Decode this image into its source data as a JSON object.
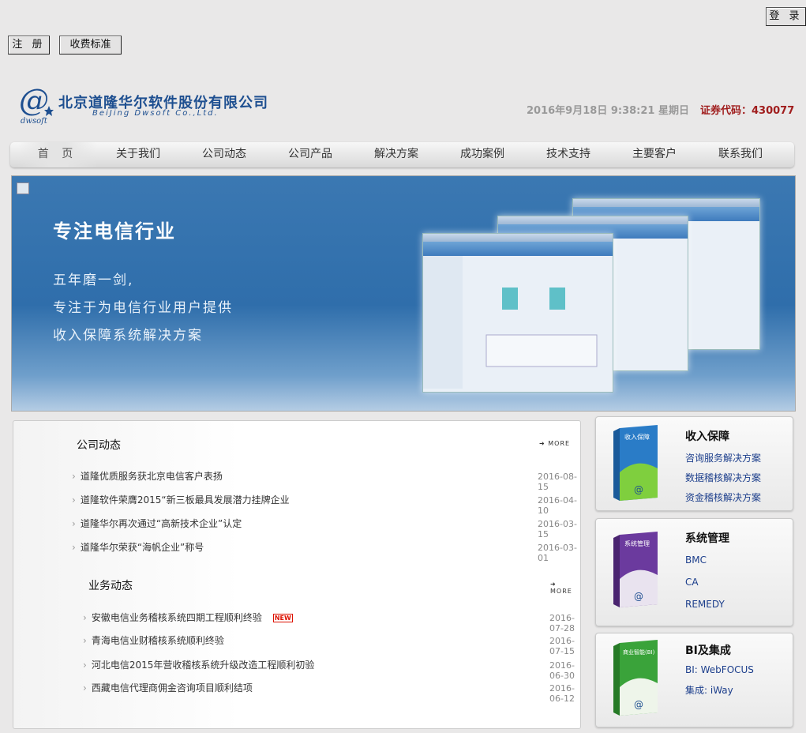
{
  "top_buttons": {
    "login": "登 录",
    "register": "注 册",
    "fees": "收费标准"
  },
  "logo": {
    "name_cn": "北京道隆华尔软件股份有限公司",
    "name_en": "BeiJing Dwsoft Co.,Ltd.",
    "mark_text": "dwsoft"
  },
  "header": {
    "datetime": "2016年9月18日  9:38:21 星期日",
    "stock": "证券代码：430077"
  },
  "nav": [
    "首 页",
    "关于我们",
    "公司动态",
    "公司产品",
    "解决方案",
    "成功案例",
    "技术支持",
    "主要客户",
    "联系我们"
  ],
  "banner": {
    "headline": "专注电信行业",
    "lines": [
      "五年磨一剑,",
      "专注于为电信行业用户提供",
      "收入保障系统解决方案"
    ]
  },
  "company_news": {
    "title": "公司动态",
    "more": "MORE",
    "items": [
      {
        "text": "道隆优质服务获北京电信客户表扬",
        "date": "2016-08-15"
      },
      {
        "text": "道隆软件荣膺2015“新三板最具发展潜力挂牌企业",
        "date": "2016-04-10"
      },
      {
        "text": "道隆华尔再次通过“高新技术企业”认定",
        "date": "2016-03-15"
      },
      {
        "text": "道隆华尔荣获“海帆企业”称号",
        "date": "2016-03-01"
      }
    ]
  },
  "business_news": {
    "title": "业务动态",
    "more": "MORE",
    "new_tag": "NEW",
    "items": [
      {
        "text": "安徽电信业务稽核系统四期工程顺利终验",
        "date": "2016-07-28"
      },
      {
        "text": "青海电信业财稽核系统顺利终验",
        "date": "2016-07-15"
      },
      {
        "text": "河北电信2015年营收稽核系统升级改造工程顺利初验",
        "date": "2016-06-30"
      },
      {
        "text": "西藏电信代理商佣金咨询项目顺利结项",
        "date": "2016-06-12"
      }
    ]
  },
  "cards": [
    {
      "title": "收入保障",
      "box_label": "收入保障",
      "links": [
        "咨询服务解决方案",
        "数据稽核解决方案",
        "资金稽核解决方案"
      ],
      "color": "#2a7cc7"
    },
    {
      "title": "系统管理",
      "box_label": "系统管理",
      "links": [
        "BMC",
        "CA",
        "REMEDY"
      ],
      "color": "#6b3a9e"
    },
    {
      "title": "BI及集成",
      "box_label": "商业智能(BI)",
      "links": [
        "BI: WebFOCUS",
        "集成: iWay"
      ],
      "color": "#3aa33a"
    }
  ]
}
